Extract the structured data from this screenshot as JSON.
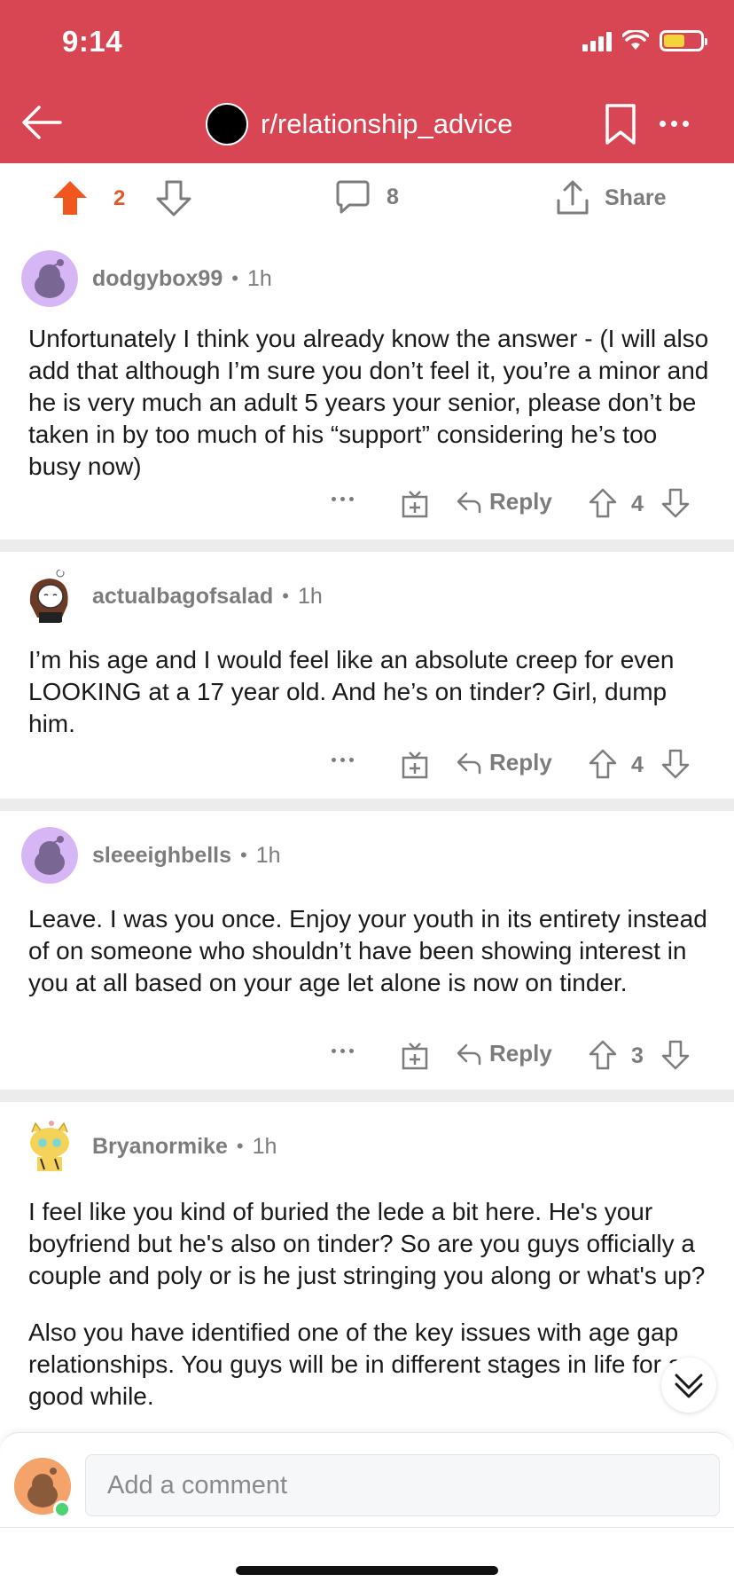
{
  "status_bar": {
    "time": "9:14"
  },
  "header": {
    "subreddit": "r/relationship_advice",
    "bg_color": "#d84653"
  },
  "post_bar": {
    "score": "2",
    "comment_count": "8",
    "share_label": "Share",
    "upvote_color": "#e0592a"
  },
  "comments": [
    {
      "username": "dodgybox99",
      "time": "1h",
      "body": [
        "Unfortunately I think you already know the answer - (I will also add that although I’m sure you don’t feel it, you’re a minor and he is very much an adult 5 years your senior, please don’t be taken in by too much of his “support” considering he’s too busy now)"
      ],
      "reply_label": "Reply",
      "score": "4",
      "avatar_icon": "snoo-purple-icon"
    },
    {
      "username": "actualbagofsalad",
      "time": "1h",
      "body": [
        "I’m his age and I would feel like an absolute creep for even LOOKING at a 17 year old. And he’s on tinder? Girl, dump him."
      ],
      "reply_label": "Reply",
      "score": "4",
      "avatar_icon": "snoo-custom-girl-icon"
    },
    {
      "username": "sleeeighbells",
      "time": "1h",
      "body": [
        "Leave. I was you once. Enjoy your youth in its entirety instead of on someone who shouldn’t have been showing interest in you at all based on your age let alone is now on tinder."
      ],
      "reply_label": "Reply",
      "score": "3",
      "avatar_icon": "snoo-purple-icon"
    },
    {
      "username": "Bryanormike",
      "time": "1h",
      "body": [
        "I feel like you kind of buried the lede a bit here. He's your boyfriend but he's also on tinder? So are you guys officially a couple and poly or is he just stringing you along or what's up?",
        "Also you have identified one of the key issues with age gap relationships.  You guys will be in different stages in life for a good while."
      ],
      "avatar_icon": "snoo-custom-tiger-icon"
    }
  ],
  "composer": {
    "placeholder": "Add a comment"
  }
}
